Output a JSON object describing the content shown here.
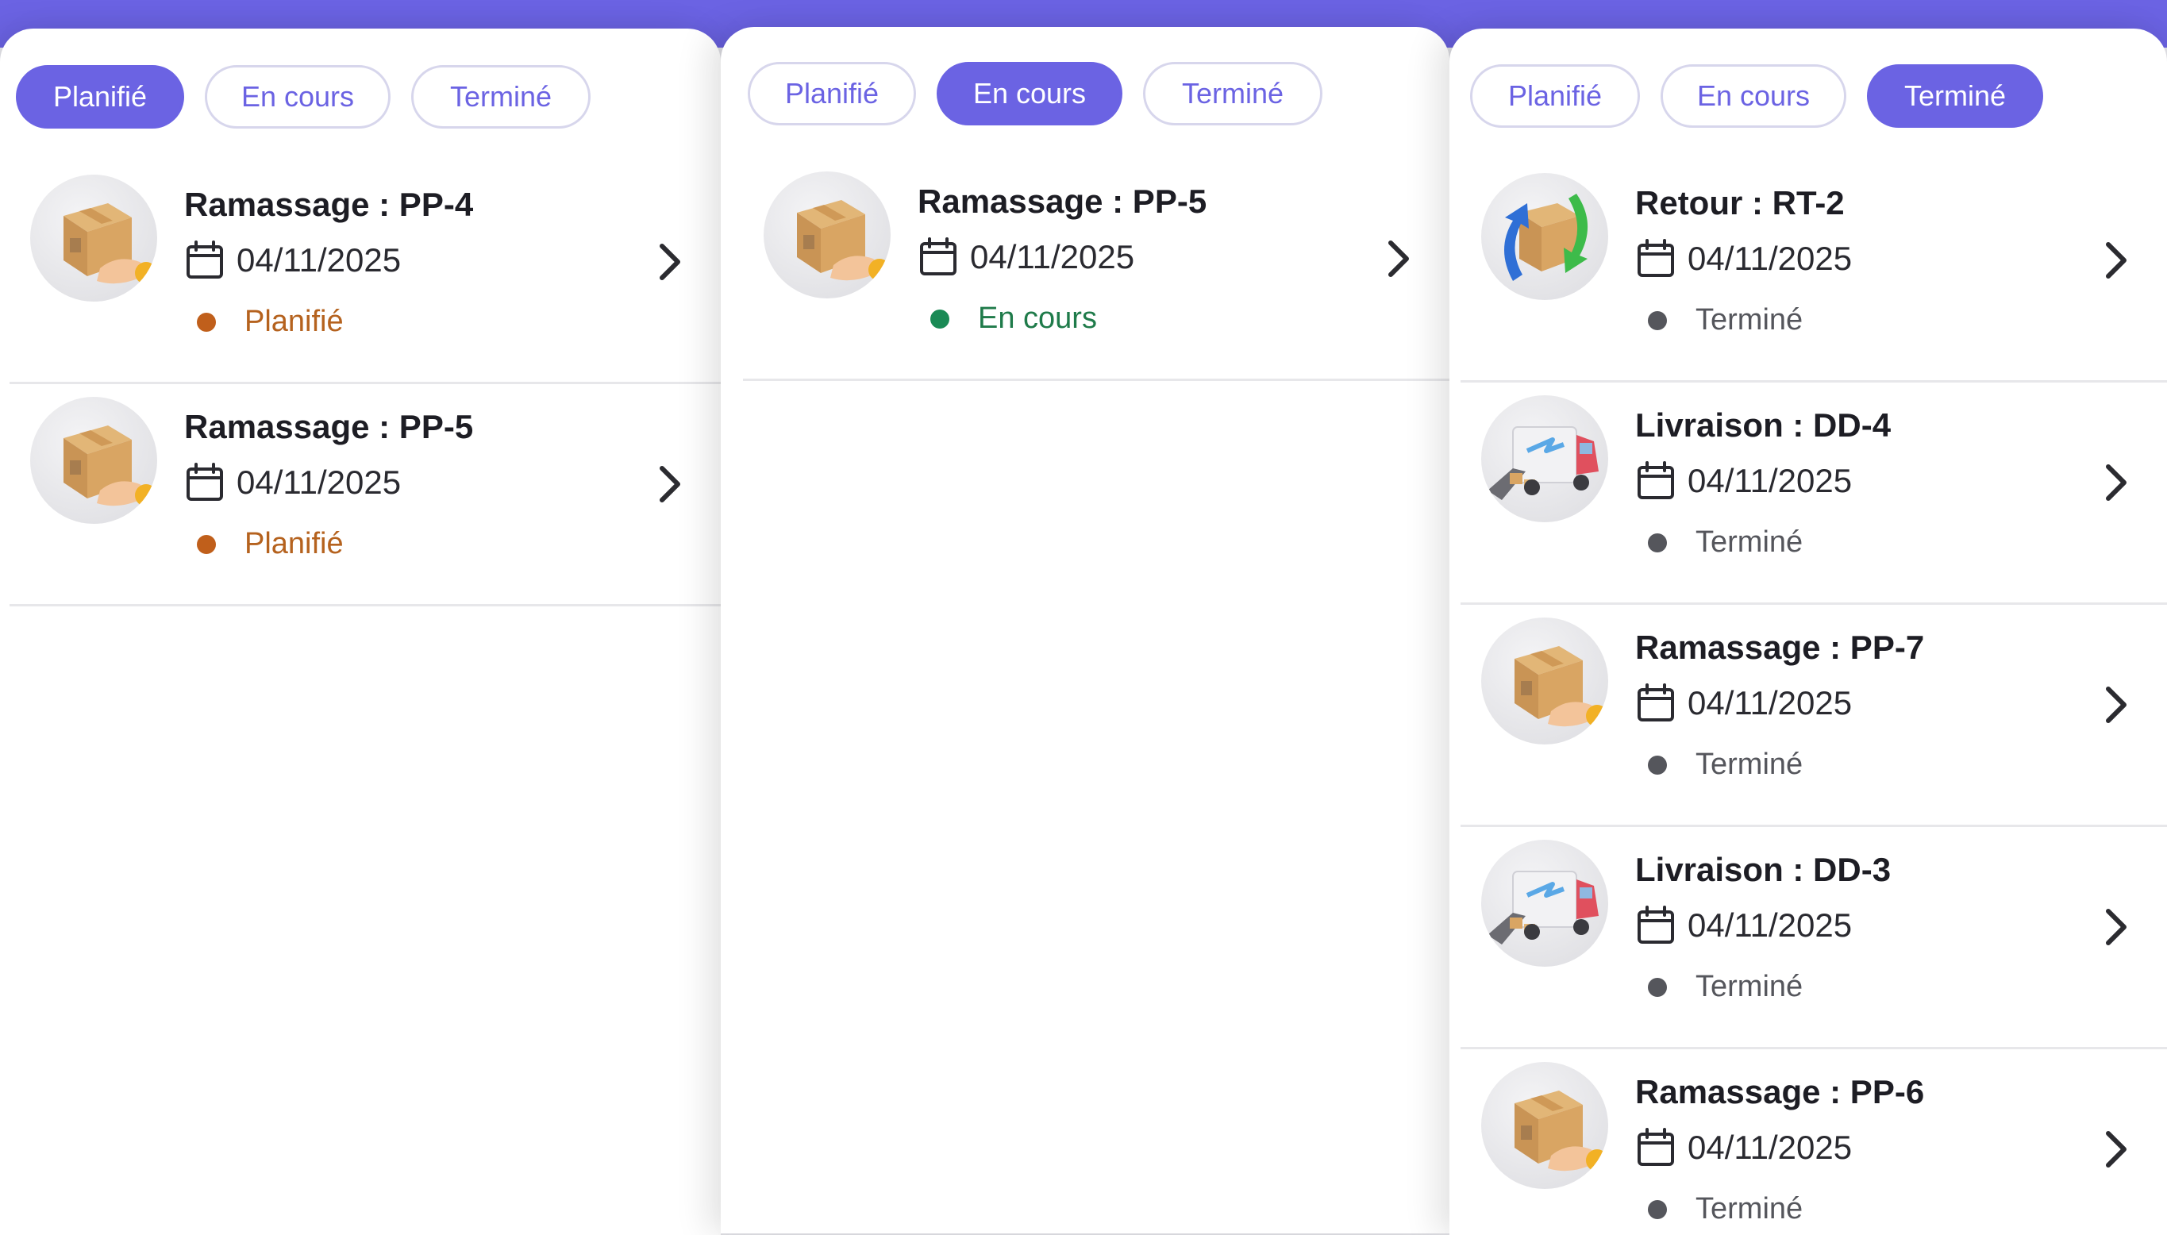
{
  "colors": {
    "accent": "#6b63e3",
    "planifie": "#c05f1b",
    "en_cours": "#1a8a55",
    "termine": "#55565c"
  },
  "tabs": {
    "planifie": "Planifié",
    "en_cours": "En cours",
    "termine": "Terminé"
  },
  "panels": {
    "planifie": {
      "items": [
        {
          "title": "Ramassage : PP-4",
          "date": "04/11/2025",
          "status": "Planifié",
          "icon": "package-hand-icon"
        },
        {
          "title": "Ramassage : PP-5",
          "date": "04/11/2025",
          "status": "Planifié",
          "icon": "package-hand-icon"
        }
      ]
    },
    "en_cours": {
      "items": [
        {
          "title": "Ramassage : PP-5",
          "date": "04/11/2025",
          "status": "En cours",
          "icon": "package-hand-icon"
        }
      ]
    },
    "termine": {
      "items": [
        {
          "title": "Retour : RT-2",
          "date": "04/11/2025",
          "status": "Terminé",
          "icon": "return-box-icon"
        },
        {
          "title": "Livraison : DD-4",
          "date": "04/11/2025",
          "status": "Terminé",
          "icon": "delivery-truck-icon"
        },
        {
          "title": "Ramassage : PP-7",
          "date": "04/11/2025",
          "status": "Terminé",
          "icon": "package-hand-icon"
        },
        {
          "title": "Livraison : DD-3",
          "date": "04/11/2025",
          "status": "Terminé",
          "icon": "delivery-truck-icon"
        },
        {
          "title": "Ramassage : PP-6",
          "date": "04/11/2025",
          "status": "Terminé",
          "icon": "package-hand-icon"
        }
      ]
    }
  }
}
